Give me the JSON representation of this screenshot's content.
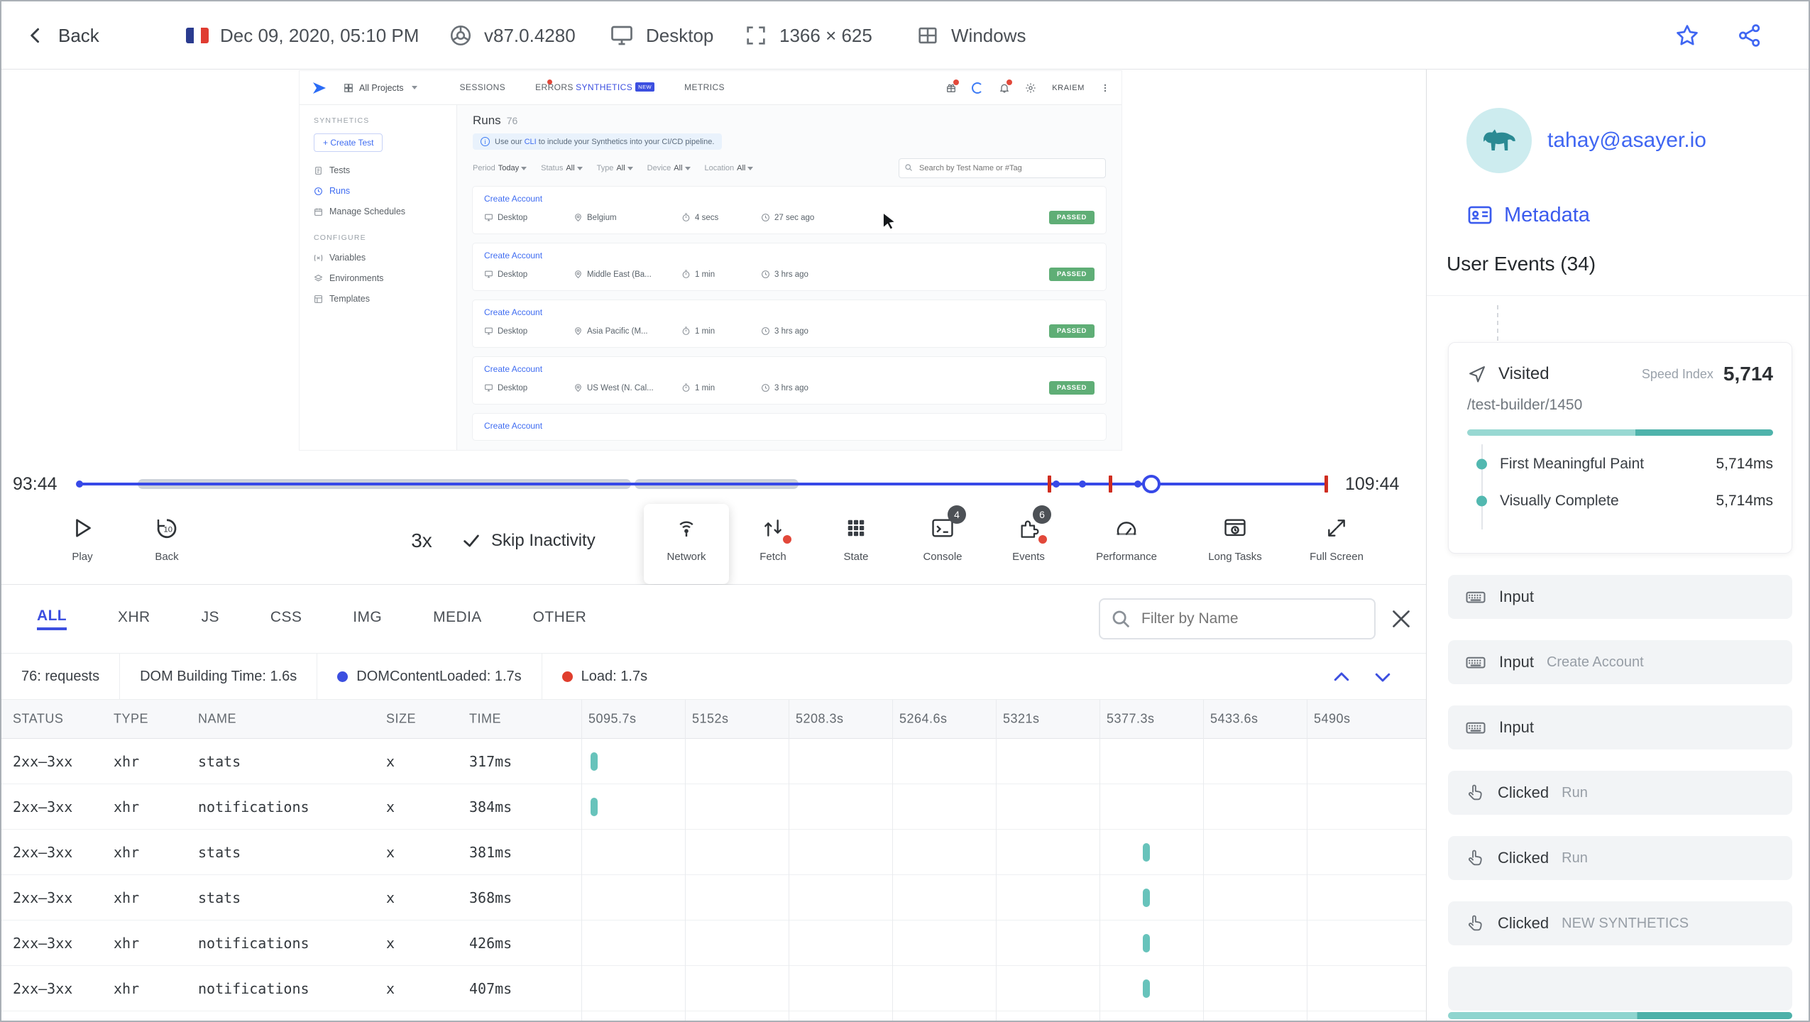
{
  "top_bar": {
    "back": "Back",
    "date": "Dec 09, 2020, 05:10 PM",
    "browser": "v87.0.4280",
    "device": "Desktop",
    "resolution": "1366 × 625",
    "os": "Windows"
  },
  "replay_app": {
    "nav": {
      "project": "All Projects",
      "tabs": [
        "SESSIONS",
        "ERRORS",
        "SYNTHETICS",
        "METRICS"
      ],
      "new_badge": "NEW",
      "user": "KRAIEM"
    },
    "sidebar": {
      "section_synthetics": "SYNTHETICS",
      "create_test": "+ Create Test",
      "tests": "Tests",
      "runs": "Runs",
      "manage_schedules": "Manage Schedules",
      "section_configure": "CONFIGURE",
      "variables": "Variables",
      "environments": "Environments",
      "templates": "Templates"
    },
    "content": {
      "title": "Runs",
      "count": "76",
      "banner": {
        "pre": "Use our ",
        "link": "CLI",
        "post": " to include your Synthetics into your CI/CD pipeline."
      },
      "filters": {
        "period_label": "Period",
        "period": "Today",
        "status_label": "Status",
        "status": "All",
        "type_label": "Type",
        "type": "All",
        "device_label": "Device",
        "device": "All",
        "location_label": "Location",
        "location": "All"
      },
      "search_placeholder": "Search by Test Name or #Tag",
      "runs": [
        {
          "name": "Create Account",
          "device": "Desktop",
          "location": "Belgium",
          "duration": "4 secs",
          "ago": "27 sec ago",
          "status": "PASSED"
        },
        {
          "name": "Create Account",
          "device": "Desktop",
          "location": "Middle East (Ba...",
          "duration": "1 min",
          "ago": "3 hrs ago",
          "status": "PASSED"
        },
        {
          "name": "Create Account",
          "device": "Desktop",
          "location": "Asia Pacific (M...",
          "duration": "1 min",
          "ago": "3 hrs ago",
          "status": "PASSED"
        },
        {
          "name": "Create Account",
          "device": "Desktop",
          "location": "US West (N. Cal...",
          "duration": "1 min",
          "ago": "3 hrs ago",
          "status": "PASSED"
        },
        {
          "name": "Create Account"
        }
      ]
    }
  },
  "timeline": {
    "elapsed": "93:44",
    "total": "109:44"
  },
  "controls": {
    "play": "Play",
    "back": "Back",
    "speed": "3x",
    "skip_inactivity": "Skip Inactivity",
    "network": "Network",
    "fetch": "Fetch",
    "state": "State",
    "console": "Console",
    "console_badge": "4",
    "events": "Events",
    "events_badge": "6",
    "performance": "Performance",
    "long_tasks": "Long Tasks",
    "full_screen": "Full Screen"
  },
  "network": {
    "tabs": [
      "ALL",
      "XHR",
      "JS",
      "CSS",
      "IMG",
      "MEDIA",
      "OTHER"
    ],
    "filter_placeholder": "Filter by Name",
    "summary": {
      "requests": "76: requests",
      "dom_building": "DOM Building Time: 1.6s",
      "dcl": "DOMContentLoaded: 1.7s",
      "load": "Load: 1.7s"
    },
    "columns": {
      "status": "STATUS",
      "type": "TYPE",
      "name": "NAME",
      "size": "SIZE",
      "time": "TIME"
    },
    "time_columns": [
      "5095.7s",
      "5152s",
      "5208.3s",
      "5264.6s",
      "5321s",
      "5377.3s",
      "5433.6s",
      "5490s"
    ],
    "rows": [
      {
        "status": "2xx–3xx",
        "type": "xhr",
        "name": "stats",
        "size": "x",
        "time": "317ms",
        "bar_left_pct": 1.1
      },
      {
        "status": "2xx–3xx",
        "type": "xhr",
        "name": "notifications",
        "size": "x",
        "time": "384ms",
        "bar_left_pct": 1.1
      },
      {
        "status": "2xx–3xx",
        "type": "xhr",
        "name": "stats",
        "size": "x",
        "time": "381ms",
        "bar_left_pct": 66.5
      },
      {
        "status": "2xx–3xx",
        "type": "xhr",
        "name": "stats",
        "size": "x",
        "time": "368ms",
        "bar_left_pct": 66.5
      },
      {
        "status": "2xx–3xx",
        "type": "xhr",
        "name": "notifications",
        "size": "x",
        "time": "426ms",
        "bar_left_pct": 66.5
      },
      {
        "status": "2xx–3xx",
        "type": "xhr",
        "name": "notifications",
        "size": "x",
        "time": "407ms",
        "bar_left_pct": 66.5
      }
    ]
  },
  "user_panel": {
    "email": "tahay@asayer.io",
    "metadata": "Metadata",
    "events_title": "User Events (34)",
    "visited": {
      "label": "Visited",
      "speed_index_label": "Speed Index",
      "speed_index": "5,714",
      "path": "/test-builder/1450",
      "fmp_label": "First Meaningful Paint",
      "fmp": "5,714ms",
      "vc_label": "Visually Complete",
      "vc": "5,714ms"
    },
    "events": [
      {
        "type": "input",
        "label": "Input",
        "value": ""
      },
      {
        "type": "input",
        "label": "Input",
        "value": "Create Account"
      },
      {
        "type": "input",
        "label": "Input",
        "value": ""
      },
      {
        "type": "click",
        "label": "Clicked",
        "value": "Run"
      },
      {
        "type": "click",
        "label": "Clicked",
        "value": "Run"
      },
      {
        "type": "click",
        "label": "Clicked",
        "value": "NEW SYNTHETICS"
      }
    ]
  },
  "colors": {
    "accent_blue": "#3c4fe0",
    "link_blue": "#3f6cf1",
    "teal": "#54b8b0",
    "green": "#5fae76",
    "red": "#e03e2d"
  }
}
